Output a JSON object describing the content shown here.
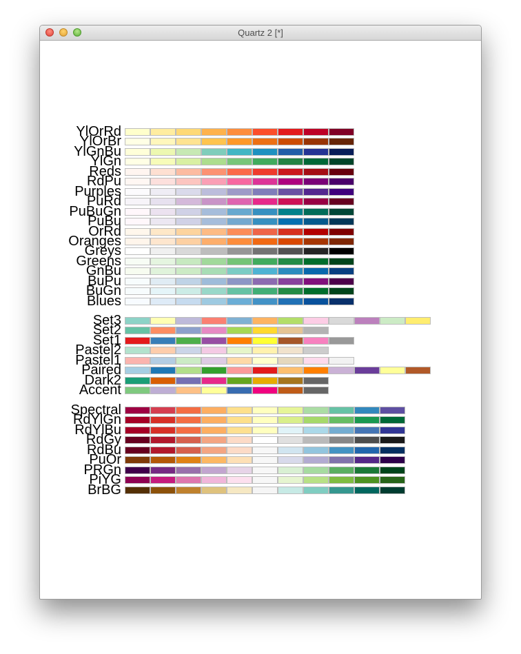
{
  "window": {
    "title": "Quartz 2 [*]"
  },
  "palettes": {
    "sequential": [
      {
        "name": "YlOrRd",
        "colors": [
          "#FFFFCC",
          "#FFEDA0",
          "#FED976",
          "#FEB24C",
          "#FD8D3C",
          "#FC4E2A",
          "#E31A1C",
          "#BD0026",
          "#800026"
        ]
      },
      {
        "name": "YlOrBr",
        "colors": [
          "#FFFFE5",
          "#FFF7BC",
          "#FEE391",
          "#FEC44F",
          "#FE9929",
          "#EC7014",
          "#CC4C02",
          "#993404",
          "#662506"
        ]
      },
      {
        "name": "YlGnBu",
        "colors": [
          "#FFFFD9",
          "#EDF8B1",
          "#C7E9B4",
          "#7FCDBB",
          "#41B6C4",
          "#1D91C0",
          "#225EA8",
          "#253494",
          "#081D58"
        ]
      },
      {
        "name": "YlGn",
        "colors": [
          "#FFFFE5",
          "#F7FCB9",
          "#D9F0A3",
          "#ADDD8E",
          "#78C679",
          "#41AB5D",
          "#238443",
          "#006837",
          "#004529"
        ]
      },
      {
        "name": "Reds",
        "colors": [
          "#FFF5F0",
          "#FEE0D2",
          "#FCBBA1",
          "#FC9272",
          "#FB6A4A",
          "#EF3B2C",
          "#CB181D",
          "#A50F15",
          "#67000D"
        ]
      },
      {
        "name": "RdPu",
        "colors": [
          "#FFF7F3",
          "#FDE0DD",
          "#FCC5C0",
          "#FA9FB5",
          "#F768A1",
          "#DD3497",
          "#AE017E",
          "#7A0177",
          "#49006A"
        ]
      },
      {
        "name": "Purples",
        "colors": [
          "#FCFBFD",
          "#EFEDF5",
          "#DADAEB",
          "#BCBDDC",
          "#9E9AC8",
          "#807DBA",
          "#6A51A3",
          "#54278F",
          "#3F007D"
        ]
      },
      {
        "name": "PuRd",
        "colors": [
          "#F7F4F9",
          "#E7E1EF",
          "#D4B9DA",
          "#C994C7",
          "#DF65B0",
          "#E7298A",
          "#CE1256",
          "#980043",
          "#67001F"
        ]
      },
      {
        "name": "PuBuGn",
        "colors": [
          "#FFF7FB",
          "#ECE2F0",
          "#D0D1E6",
          "#A6BDDB",
          "#67A9CF",
          "#3690C0",
          "#02818A",
          "#016C59",
          "#014636"
        ]
      },
      {
        "name": "PuBu",
        "colors": [
          "#FFF7FB",
          "#ECE7F2",
          "#D0D1E6",
          "#A6BDDB",
          "#74A9CF",
          "#3690C0",
          "#0570B0",
          "#045A8D",
          "#023858"
        ]
      },
      {
        "name": "OrRd",
        "colors": [
          "#FFF7EC",
          "#FEE8C8",
          "#FDD49E",
          "#FDBB84",
          "#FC8D59",
          "#EF6548",
          "#D7301F",
          "#B30000",
          "#7F0000"
        ]
      },
      {
        "name": "Oranges",
        "colors": [
          "#FFF5EB",
          "#FEE6CE",
          "#FDD0A2",
          "#FDAE6B",
          "#FD8D3C",
          "#F16913",
          "#D94801",
          "#A63603",
          "#7F2704"
        ]
      },
      {
        "name": "Greys",
        "colors": [
          "#FFFFFF",
          "#F0F0F0",
          "#D9D9D9",
          "#BDBDBD",
          "#969696",
          "#737373",
          "#525252",
          "#252525",
          "#000000"
        ]
      },
      {
        "name": "Greens",
        "colors": [
          "#F7FCF5",
          "#E5F5E0",
          "#C7E9C0",
          "#A1D99B",
          "#74C476",
          "#41AB5D",
          "#238B45",
          "#006D2C",
          "#00441B"
        ]
      },
      {
        "name": "GnBu",
        "colors": [
          "#F7FCF0",
          "#E0F3DB",
          "#CCEBC5",
          "#A8DDB5",
          "#7BCCC4",
          "#4EB3D3",
          "#2B8CBE",
          "#0868AC",
          "#084081"
        ]
      },
      {
        "name": "BuPu",
        "colors": [
          "#F7FCFD",
          "#E0ECF4",
          "#BFD3E6",
          "#9EBCDA",
          "#8C96C6",
          "#8C6BB1",
          "#88419D",
          "#810F7C",
          "#4D004B"
        ]
      },
      {
        "name": "BuGn",
        "colors": [
          "#F7FCFD",
          "#E5F5F9",
          "#CCECE6",
          "#99D8C9",
          "#66C2A4",
          "#41AE76",
          "#238B45",
          "#006D2C",
          "#00441B"
        ]
      },
      {
        "name": "Blues",
        "colors": [
          "#F7FBFF",
          "#DEEBF7",
          "#C6DBEF",
          "#9ECAE1",
          "#6BAED6",
          "#4292C6",
          "#2171B5",
          "#08519C",
          "#08306B"
        ]
      }
    ],
    "qualitative": [
      {
        "name": "Set3",
        "colors": [
          "#8DD3C7",
          "#FFFFB3",
          "#BEBADA",
          "#FB8072",
          "#80B1D3",
          "#FDB462",
          "#B3DE69",
          "#FCCDE5",
          "#D9D9D9",
          "#BC80BD",
          "#CCEBC5",
          "#FFED6F"
        ]
      },
      {
        "name": "Set2",
        "colors": [
          "#66C2A5",
          "#FC8D62",
          "#8DA0CB",
          "#E78AC3",
          "#A6D854",
          "#FFD92F",
          "#E5C494",
          "#B3B3B3"
        ]
      },
      {
        "name": "Set1",
        "colors": [
          "#E41A1C",
          "#377EB8",
          "#4DAF4A",
          "#984EA3",
          "#FF7F00",
          "#FFFF33",
          "#A65628",
          "#F781BF",
          "#999999"
        ]
      },
      {
        "name": "Pastel2",
        "colors": [
          "#B3E2CD",
          "#FDCDAC",
          "#CBD5E8",
          "#F4CAE4",
          "#E6F5C9",
          "#FFF2AE",
          "#F1E2CC",
          "#CCCCCC"
        ]
      },
      {
        "name": "Pastel1",
        "colors": [
          "#FBB4AE",
          "#B3CDE3",
          "#CCEBC5",
          "#DECBE4",
          "#FED9A6",
          "#FFFFCC",
          "#E5D8BD",
          "#FDDAEC",
          "#F2F2F2"
        ]
      },
      {
        "name": "Paired",
        "colors": [
          "#A6CEE3",
          "#1F78B4",
          "#B2DF8A",
          "#33A02C",
          "#FB9A99",
          "#E31A1C",
          "#FDBF6F",
          "#FF7F00",
          "#CAB2D6",
          "#6A3D9A",
          "#FFFF99",
          "#B15928"
        ]
      },
      {
        "name": "Dark2",
        "colors": [
          "#1B9E77",
          "#D95F02",
          "#7570B3",
          "#E7298A",
          "#66A61E",
          "#E6AB02",
          "#A6761D",
          "#666666"
        ]
      },
      {
        "name": "Accent",
        "colors": [
          "#7FC97F",
          "#BEAED4",
          "#FDC086",
          "#FFFF99",
          "#386CB0",
          "#F0027F",
          "#BF5B17",
          "#666666"
        ]
      }
    ],
    "diverging": [
      {
        "name": "Spectral",
        "colors": [
          "#9E0142",
          "#D53E4F",
          "#F46D43",
          "#FDAE61",
          "#FEE08B",
          "#FFFFBF",
          "#E6F598",
          "#ABDDA4",
          "#66C2A5",
          "#3288BD",
          "#5E4FA2"
        ]
      },
      {
        "name": "RdYlGn",
        "colors": [
          "#A50026",
          "#D73027",
          "#F46D43",
          "#FDAE61",
          "#FEE08B",
          "#FFFFBF",
          "#D9EF8B",
          "#A6D96A",
          "#66BD63",
          "#1A9850",
          "#006837"
        ]
      },
      {
        "name": "RdYlBu",
        "colors": [
          "#A50026",
          "#D73027",
          "#F46D43",
          "#FDAE61",
          "#FEE090",
          "#FFFFBF",
          "#E0F3F8",
          "#ABD9E9",
          "#74ADD1",
          "#4575B4",
          "#313695"
        ]
      },
      {
        "name": "RdGy",
        "colors": [
          "#67001F",
          "#B2182B",
          "#D6604D",
          "#F4A582",
          "#FDDBC7",
          "#FFFFFF",
          "#E0E0E0",
          "#BABABA",
          "#878787",
          "#4D4D4D",
          "#1A1A1A"
        ]
      },
      {
        "name": "RdBu",
        "colors": [
          "#67001F",
          "#B2182B",
          "#D6604D",
          "#F4A582",
          "#FDDBC7",
          "#F7F7F7",
          "#D1E5F0",
          "#92C5DE",
          "#4393C3",
          "#2166AC",
          "#053061"
        ]
      },
      {
        "name": "PuOr",
        "colors": [
          "#7F3B08",
          "#B35806",
          "#E08214",
          "#FDB863",
          "#FEE0B6",
          "#F7F7F7",
          "#D8DAEB",
          "#B2ABD2",
          "#8073AC",
          "#542788",
          "#2D004B"
        ]
      },
      {
        "name": "PRGn",
        "colors": [
          "#40004B",
          "#762A83",
          "#9970AB",
          "#C2A5CF",
          "#E7D4E8",
          "#F7F7F7",
          "#D9F0D3",
          "#A6DBA0",
          "#5AAE61",
          "#1B7837",
          "#00441B"
        ]
      },
      {
        "name": "PiYG",
        "colors": [
          "#8E0152",
          "#C51B7D",
          "#DE77AE",
          "#F1B6DA",
          "#FDE0EF",
          "#F7F7F7",
          "#E6F5D0",
          "#B8E186",
          "#7FBC41",
          "#4D9221",
          "#276419"
        ]
      },
      {
        "name": "BrBG",
        "colors": [
          "#543005",
          "#8C510A",
          "#BF812D",
          "#DFC27D",
          "#F6E8C3",
          "#F5F5F5",
          "#C7EAE5",
          "#80CDC1",
          "#35978F",
          "#01665E",
          "#003C30"
        ]
      }
    ]
  }
}
